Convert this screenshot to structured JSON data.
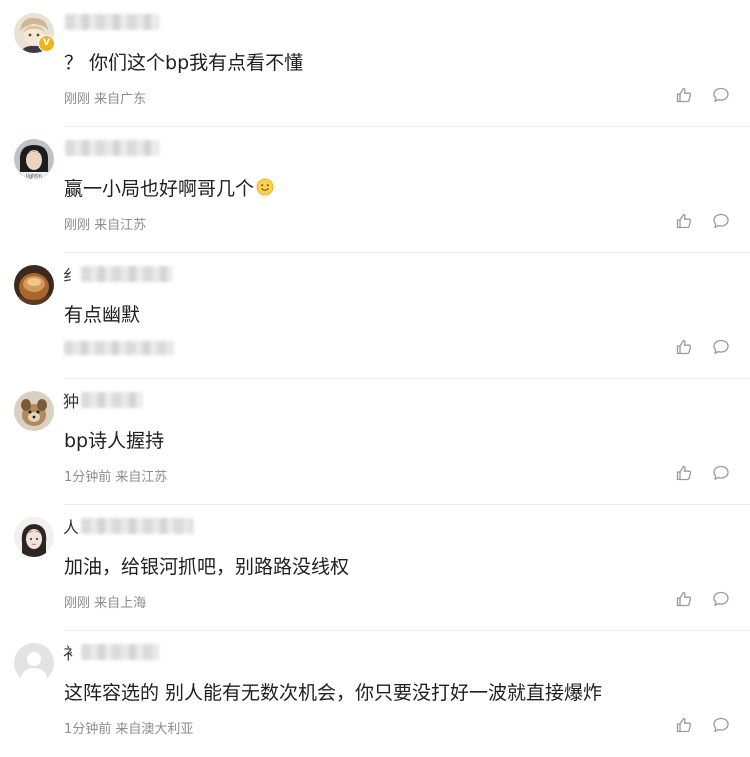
{
  "comments": [
    {
      "name_prefix": "",
      "text": "？ 你们这个bp我有点看不懂",
      "time": "刚刚",
      "location": "来自广东",
      "vip_badge": "V",
      "has_emoji": false
    },
    {
      "name_prefix": "",
      "text": "赢一小局也好啊哥几个",
      "time": "刚刚",
      "location": "来自江苏",
      "has_emoji": true,
      "emoji_icon": "smile-emoji-icon"
    },
    {
      "name_prefix": "纟",
      "text": "有点幽默",
      "time": "",
      "location": "",
      "has_emoji": false
    },
    {
      "name_prefix": "狆",
      "text": "bp诗人握持",
      "time": "1分钟前",
      "location": "来自江苏",
      "has_emoji": false
    },
    {
      "name_prefix": "人",
      "text": "加油，给银河抓吧，别路路没线权",
      "time": "刚刚",
      "location": "来自上海",
      "has_emoji": false
    },
    {
      "name_prefix": "衤",
      "text": "这阵容选的 别人能有无数次机会，你只要没打好一波就直接爆炸",
      "time": "1分钟前",
      "location": "来自澳大利亚",
      "has_emoji": false
    }
  ],
  "icons": {
    "like": "thumbs-up-icon",
    "reply": "comment-bubble-icon"
  },
  "colors": {
    "text": "#1f1f1f",
    "meta": "#8c8c8c",
    "icon": "#9a9a9a",
    "divider": "#ececec",
    "vip": "#f2b21b"
  }
}
